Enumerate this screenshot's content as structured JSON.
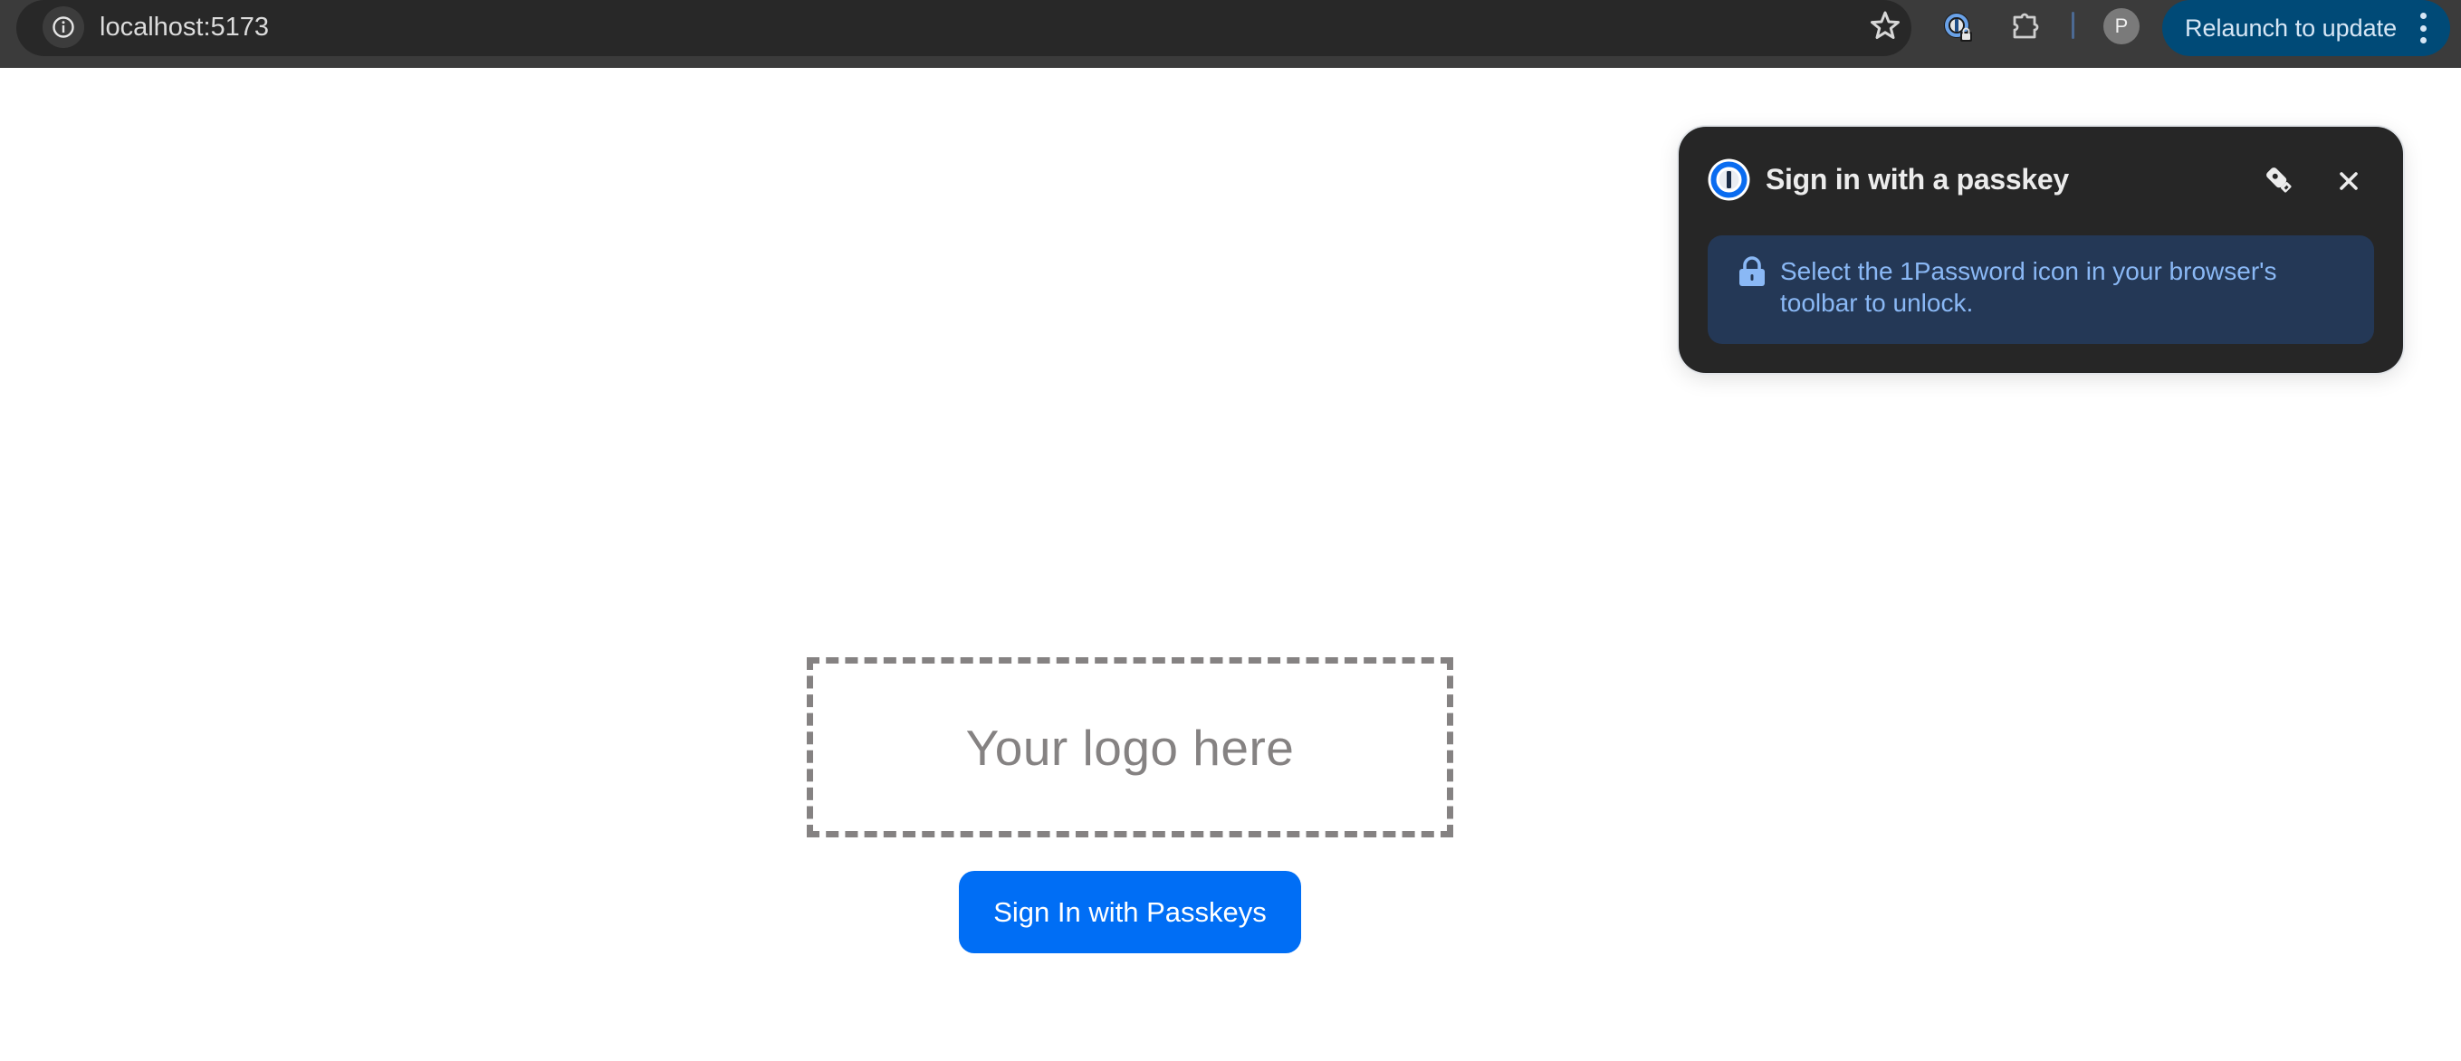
{
  "browser": {
    "url": "localhost:5173",
    "site_info_icon": "info-icon",
    "bookmark_icon": "star-icon",
    "extensions": [
      {
        "name": "1password-extension",
        "icon": "1password-locked-icon"
      },
      {
        "name": "extensions-menu",
        "icon": "puzzle-icon"
      }
    ],
    "profile_initial": "P",
    "relaunch_label": "Relaunch to update",
    "menu_icon": "more-vert-icon"
  },
  "passkey_popup": {
    "logo_icon": "1password-logo-icon",
    "title": "Sign in with a passkey",
    "key_icon": "security-key-icon",
    "close_icon": "close-icon",
    "notice": {
      "icon": "lock-icon",
      "text": "Select the 1Password icon in your browser's toolbar to unlock."
    },
    "colors": {
      "background": "#262626",
      "notice_background": "#243856",
      "notice_text": "#8ab8f5"
    }
  },
  "page": {
    "logo_placeholder": "Your logo here",
    "signin_button": "Sign In with Passkeys",
    "colors": {
      "primary": "#006ef5",
      "placeholder": "#858282"
    }
  }
}
